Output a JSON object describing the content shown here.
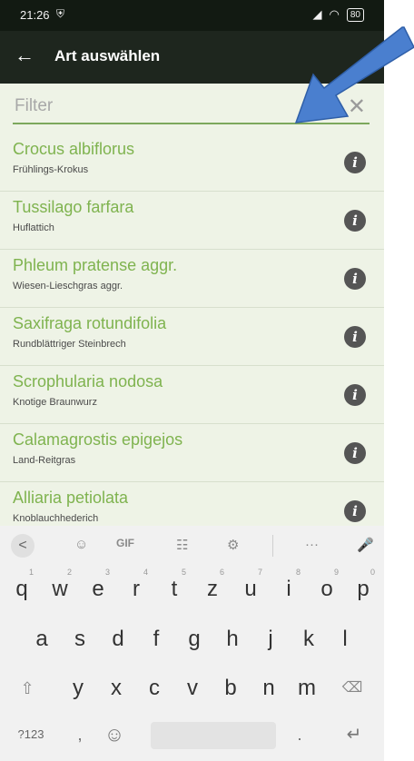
{
  "status_bar": {
    "time": "21:26",
    "left_icon": "shield-icon",
    "signal": "signal-icon",
    "wifi": "wifi-icon",
    "battery": "80"
  },
  "app_bar": {
    "back_icon": "back-arrow-icon",
    "title": "Art auswählen"
  },
  "filter": {
    "placeholder": "Filter",
    "value": "",
    "clear_icon": "close-icon"
  },
  "species": [
    {
      "scientific": "Crocus albiflorus",
      "common": "Frühlings-Krokus"
    },
    {
      "scientific": "Tussilago farfara",
      "common": "Huflattich"
    },
    {
      "scientific": "Phleum pratense aggr.",
      "common": "Wiesen-Lieschgras aggr."
    },
    {
      "scientific": "Saxifraga rotundifolia",
      "common": "Rundblättriger Steinbrech"
    },
    {
      "scientific": "Scrophularia nodosa",
      "common": "Knotige Braunwurz"
    },
    {
      "scientific": "Calamagrostis epigejos",
      "common": "Land-Reitgras"
    },
    {
      "scientific": "Alliaria petiolata",
      "common": "Knoblauchhederich"
    }
  ],
  "keyboard": {
    "toolbar": {
      "collapse": "<",
      "gif": "GIF",
      "more": "···"
    },
    "row1": [
      "q",
      "w",
      "e",
      "r",
      "t",
      "z",
      "u",
      "i",
      "o",
      "p"
    ],
    "row1_hints": [
      "1",
      "2",
      "3",
      "4",
      "5",
      "6",
      "7",
      "8",
      "9",
      "0"
    ],
    "row2": [
      "a",
      "s",
      "d",
      "f",
      "g",
      "h",
      "j",
      "k",
      "l"
    ],
    "row3": [
      "y",
      "x",
      "c",
      "v",
      "b",
      "n",
      "m"
    ],
    "row4": {
      "symbols": "?123",
      "comma": ",",
      "period": "."
    }
  },
  "colors": {
    "accent_green": "#7fb34f",
    "annotation_arrow": "#4a7fcf"
  }
}
